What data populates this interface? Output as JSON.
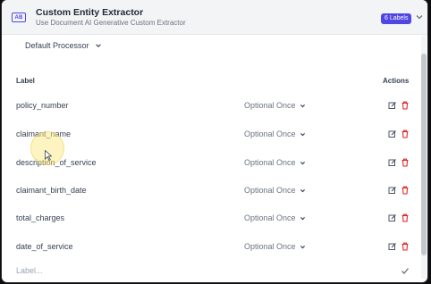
{
  "header": {
    "icon_text": "AB",
    "title": "Custom Entity Extractor",
    "subtitle": "Use Document AI Generative Custom Extractor",
    "badge": "6 Labels"
  },
  "processor": {
    "label": "Default Processor"
  },
  "table": {
    "columns": {
      "label": "Label",
      "actions": "Actions"
    },
    "rows": [
      {
        "label": "policy_number",
        "occurrence": "Optional Once"
      },
      {
        "label": "claimant_name",
        "occurrence": "Optional Once"
      },
      {
        "label": "description_of_service",
        "occurrence": "Optional Once"
      },
      {
        "label": "claimant_birth_date",
        "occurrence": "Optional Once"
      },
      {
        "label": "total_charges",
        "occurrence": "Optional Once"
      },
      {
        "label": "date_of_service",
        "occurrence": "Optional Once"
      }
    ]
  },
  "new_label": {
    "placeholder": "Label..."
  },
  "colors": {
    "accent": "#4f46e5",
    "delete": "#dc2626",
    "text": "#374151",
    "muted": "#6b7280"
  }
}
